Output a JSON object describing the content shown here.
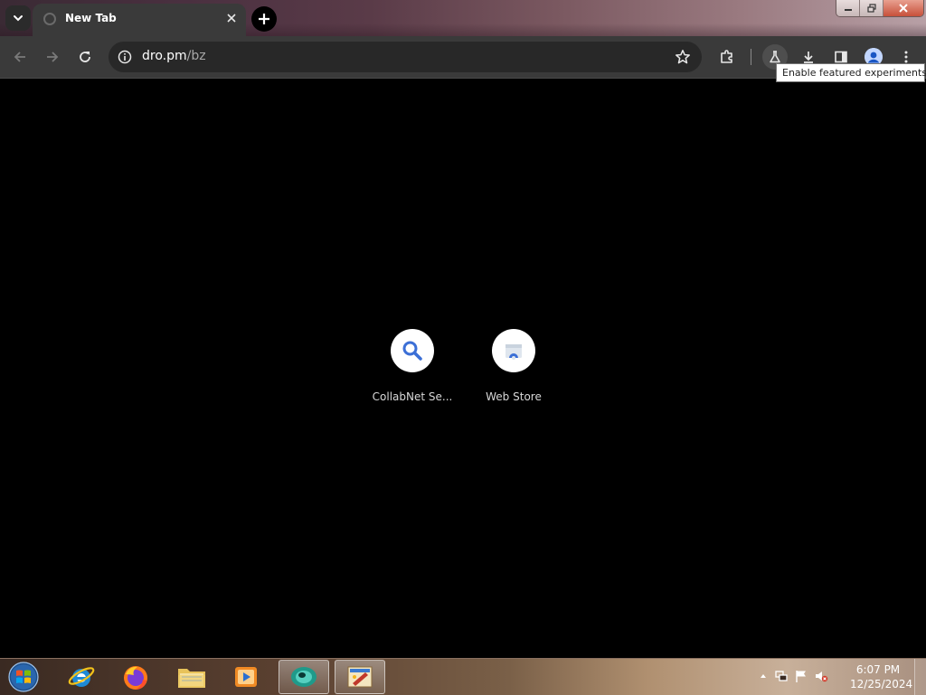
{
  "browser": {
    "tab": {
      "title": "New Tab"
    },
    "address": {
      "host": "dro.pm",
      "path": "/bz"
    },
    "tooltip": "Enable featured experiments"
  },
  "shortcuts": [
    {
      "label": "CollabNet Se...",
      "icon": "magnifier-icon"
    },
    {
      "label": "Web Store",
      "icon": "web-store-icon"
    }
  ],
  "taskbar": {
    "apps": [
      "windows-start",
      "internet-explorer",
      "firefox",
      "file-explorer",
      "media-player",
      "chrome",
      "paint"
    ],
    "clock": {
      "time": "6:07 PM",
      "date": "12/25/2024"
    }
  },
  "colors": {
    "toolbar": "#3a3a3a",
    "omnibox": "#282828",
    "page": "#000000",
    "accent_blue": "#3b6fd6"
  }
}
